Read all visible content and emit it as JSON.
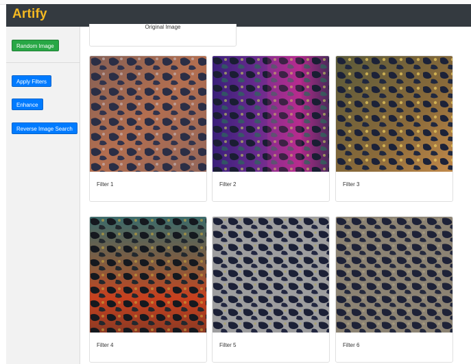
{
  "app": {
    "brand": "Artify"
  },
  "sidebar": {
    "random_label": "Random Image",
    "apply_label": "Apply Filters",
    "enhance_label": "Enhance",
    "reverse_label": "Reverse Image Search"
  },
  "original": {
    "label": "Original Image"
  },
  "filters": [
    {
      "label": "Filter 1"
    },
    {
      "label": "Filter 2"
    },
    {
      "label": "Filter 3"
    },
    {
      "label": "Filter 4"
    },
    {
      "label": "Filter 5"
    },
    {
      "label": "Filter 6"
    }
  ],
  "colors": {
    "navbar": "#343a40",
    "brand": "#f5b921",
    "btn_green": "#28a745",
    "btn_blue": "#007bff"
  }
}
